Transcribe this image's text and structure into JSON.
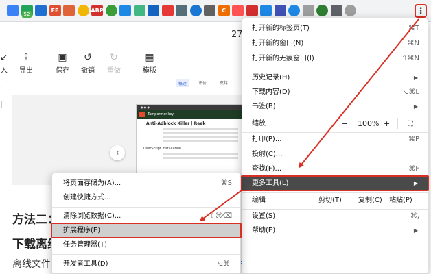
{
  "browser": {
    "extensions": [
      {
        "icon": "funnel-extension-icon",
        "color": "#3b82f6"
      },
      {
        "icon": "puzzle-extension-icon",
        "color": "#22a35a",
        "badge": "52"
      },
      {
        "icon": "s-extension-icon",
        "color": "#1f6fd1"
      },
      {
        "icon": "fe-extension-icon",
        "color": "#e04f2f",
        "text": "FE"
      },
      {
        "icon": "ppt-extension-icon",
        "color": "#e0643a"
      },
      {
        "icon": "compass-extension-icon",
        "color": "#f2b705"
      },
      {
        "icon": "abp-extension-icon",
        "color": "#d32f2f",
        "text": "ABP"
      },
      {
        "icon": "paw-extension-icon",
        "color": "#3a9d3a"
      },
      {
        "icon": "g-extension-icon",
        "color": "#1e88e5"
      },
      {
        "icon": "vue-extension-icon",
        "color": "#41b883"
      },
      {
        "icon": "y-extension-icon",
        "color": "#1565c0"
      },
      {
        "icon": "cube-extension-icon",
        "color": "#e53935"
      },
      {
        "icon": "copy-extension-icon",
        "color": "#546e7a"
      },
      {
        "icon": "eye-extension-icon",
        "color": "#1976d2"
      },
      {
        "icon": "bracket-extension-icon",
        "color": "#616161"
      },
      {
        "icon": "c-extension-icon",
        "color": "#ef6c00",
        "text": "C"
      },
      {
        "icon": "notes-extension-icon",
        "color": "#ff5252"
      },
      {
        "icon": "search-extension-icon",
        "color": "#d32f2f"
      },
      {
        "icon": "translate-extension-icon",
        "color": "#1e88e5"
      },
      {
        "icon": "edit-extension-icon",
        "color": "#3f51b5"
      },
      {
        "icon": "swirl-extension-icon",
        "color": "#1e88e5"
      },
      {
        "icon": "grid-extension-icon",
        "color": "#9e9e9e"
      },
      {
        "icon": "download-extension-icon",
        "color": "#2e7d32"
      },
      {
        "icon": "puzzle-icon",
        "color": "#5f6368"
      },
      {
        "icon": "profile-icon",
        "color": "#9e9e9e"
      }
    ],
    "page_number_partial": "27"
  },
  "editor_toolbar": {
    "import_partial": "入",
    "export": "导出",
    "save": "保存",
    "undo": "撤销",
    "redo": "重做",
    "template": "模版"
  },
  "embed": {
    "tabs": [
      "概述",
      "评价",
      "支持"
    ],
    "mini_header": "Tampermonkey",
    "mini_title": "Anti-Adblock Killer | Reek",
    "mini_sub": "UserScript installation"
  },
  "article": {
    "heading1_partial": "方法二：",
    "heading2_partial": "下载离线",
    "para_partial": "离线文件"
  },
  "menu": {
    "items": [
      {
        "label": "打开新的标签页(T)",
        "shortcut": "⌘T"
      },
      {
        "label": "打开新的窗口(N)",
        "shortcut": "⌘N"
      },
      {
        "label": "打开新的无痕窗口(I)",
        "shortcut": "⇧⌘N"
      },
      {
        "label": "历史记录(H)",
        "shortcut": "▶"
      },
      {
        "label": "下载内容(D)",
        "shortcut": "⌥⌘L"
      },
      {
        "label": "书签(B)",
        "shortcut": "▶"
      },
      {
        "label": "打印(P)...",
        "shortcut": "⌘P"
      },
      {
        "label": "投射(C)...",
        "shortcut": ""
      },
      {
        "label": "查找(F)...",
        "shortcut": "⌘F"
      },
      {
        "label": "更多工具(L)",
        "shortcut": "▶"
      },
      {
        "label": "设置(S)",
        "shortcut": "⌘,"
      },
      {
        "label": "帮助(E)",
        "shortcut": "▶"
      }
    ],
    "zoom": {
      "label": "缩放",
      "minus": "−",
      "value": "100%",
      "plus": "+",
      "fullscreen": "⛶"
    },
    "edit": {
      "label": "编辑",
      "cut": "剪切(T)",
      "copy": "复制(C)",
      "paste": "粘贴(P)"
    }
  },
  "submenu": {
    "items": [
      {
        "label": "将页面存储为(A)...",
        "shortcut": "⌘S"
      },
      {
        "label": "创建快捷方式...",
        "shortcut": ""
      },
      {
        "label": "清除浏览数据(C)...",
        "shortcut": "⇧⌘⌫"
      },
      {
        "label": "扩展程序(E)",
        "shortcut": ""
      },
      {
        "label": "任务管理器(T)",
        "shortcut": ""
      },
      {
        "label": "开发者工具(D)",
        "shortcut": "⌥⌘I"
      }
    ]
  },
  "colors": {
    "annotation": "#d93025",
    "highlight": "#4a4a4a",
    "sub_highlight": "#cfcfcf"
  }
}
